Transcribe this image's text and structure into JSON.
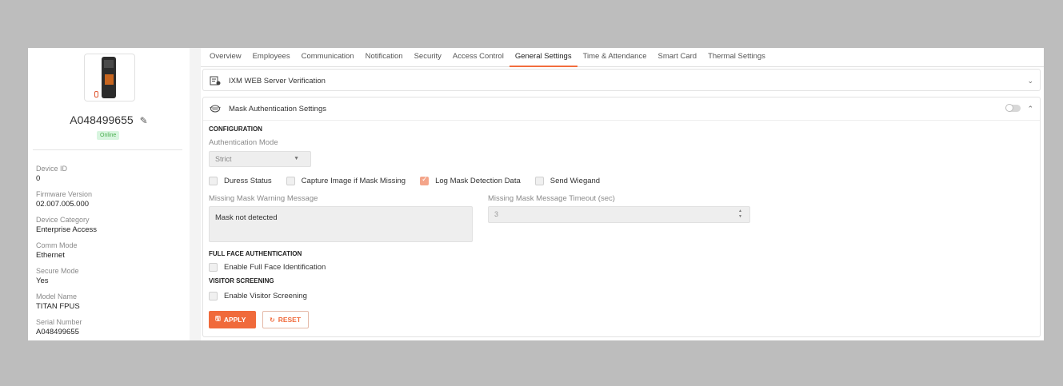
{
  "device": {
    "name": "A048499655",
    "status": "Online"
  },
  "info": [
    {
      "label": "Device ID",
      "value": "0"
    },
    {
      "label": "Firmware Version",
      "value": "02.007.005.000"
    },
    {
      "label": "Device Category",
      "value": "Enterprise Access"
    },
    {
      "label": "Comm Mode",
      "value": "Ethernet"
    },
    {
      "label": "Secure Mode",
      "value": "Yes"
    },
    {
      "label": "Model Name",
      "value": "TITAN FPUS"
    },
    {
      "label": "Serial Number",
      "value": "A048499655"
    }
  ],
  "tabs": [
    "Overview",
    "Employees",
    "Communication",
    "Notification",
    "Security",
    "Access Control",
    "General Settings",
    "Time & Attendance",
    "Smart Card",
    "Thermal Settings"
  ],
  "active_tab": "General Settings",
  "sections": {
    "ixm": {
      "title": "IXM WEB Server Verification",
      "chevron": "⌄"
    },
    "mask": {
      "title": "Mask Authentication Settings",
      "chevron": "⌃",
      "enabled": false,
      "configuration_title": "CONFIGURATION",
      "auth_mode_label": "Authentication Mode",
      "auth_mode_value": "Strict",
      "checkboxes": {
        "duress": {
          "label": "Duress Status",
          "checked": false
        },
        "capture": {
          "label": "Capture Image if Mask Missing",
          "checked": false
        },
        "log": {
          "label": "Log Mask Detection Data",
          "checked": true
        },
        "wiegand": {
          "label": "Send Wiegand",
          "checked": false
        }
      },
      "warning_label": "Missing Mask Warning Message",
      "warning_value": "Mask not detected",
      "timeout_label": "Missing Mask Message Timeout (sec)",
      "timeout_value": "3",
      "full_face_title": "FULL FACE AUTHENTICATION",
      "full_face_label": "Enable Full Face Identification",
      "visitor_title": "VISITOR SCREENING",
      "visitor_label": "Enable Visitor Screening",
      "apply_label": "APPLY",
      "reset_label": "RESET"
    }
  },
  "colors": {
    "accent": "#f06a3b",
    "online": "#4caf50",
    "background": "#bdbdbd"
  }
}
